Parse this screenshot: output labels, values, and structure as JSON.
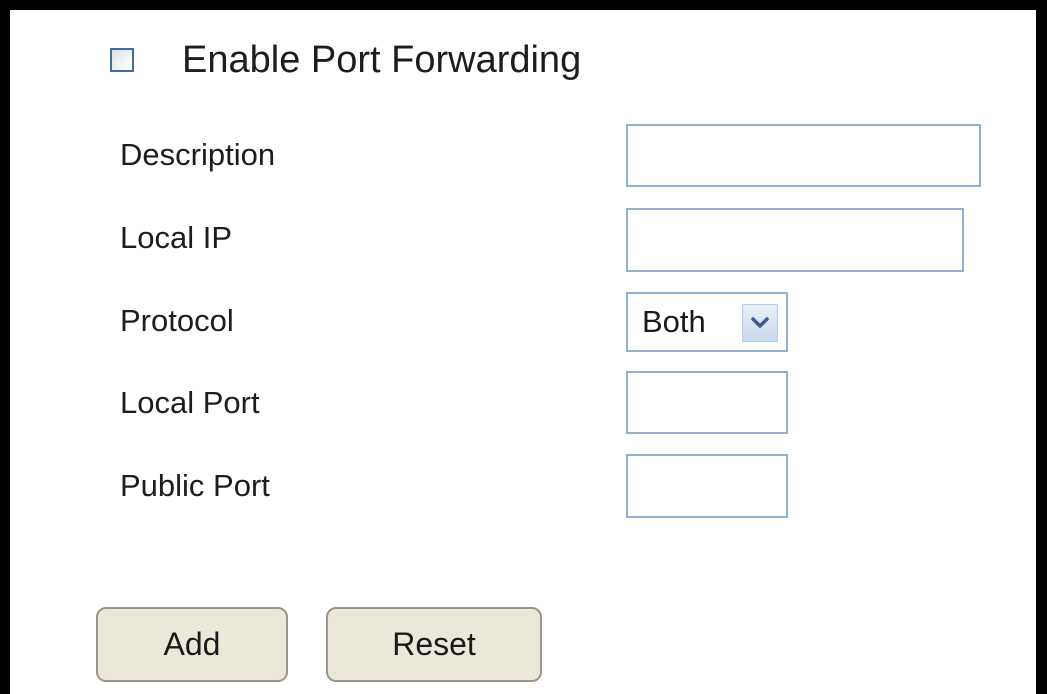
{
  "form": {
    "enable_label": "Enable Port Forwarding",
    "enable_checked": false,
    "fields": {
      "description": {
        "label": "Description",
        "value": ""
      },
      "local_ip": {
        "label": "Local IP",
        "value": ""
      },
      "protocol": {
        "label": "Protocol",
        "selected": "Both"
      },
      "local_port": {
        "label": "Local Port",
        "value": ""
      },
      "public_port": {
        "label": "Public Port",
        "value": ""
      }
    }
  },
  "buttons": {
    "add": "Add",
    "reset": "Reset"
  },
  "colors": {
    "frame": "#000000",
    "input_border": "#8fb0d0",
    "checkbox_border": "#3f6ea3",
    "button_bg": "#ebe8da",
    "button_border": "#9a9786"
  },
  "icons": {
    "dropdown": "chevron-down-icon"
  }
}
